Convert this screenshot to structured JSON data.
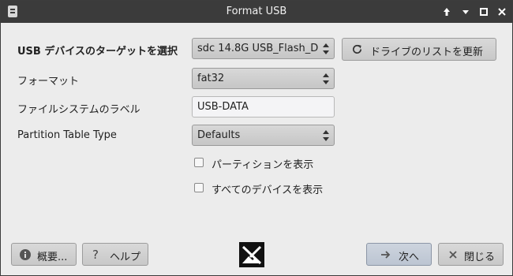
{
  "window": {
    "title": "Format USB",
    "controls": {
      "up_label": "↑",
      "minimize_label": "▾",
      "maximize_label": "□",
      "close_label": "✕"
    }
  },
  "form": {
    "target_label": "USB デバイスのターゲットを選択",
    "target_value": "sdc  14.8G USB_Flash_D",
    "refresh_label": "ドライブのリストを更新",
    "format_label": "フォーマット",
    "format_value": "fat32",
    "fs_label_label": "ファイルシステムのラベル",
    "fs_label_value": "USB-DATA",
    "partition_label": "Partition Table Type",
    "partition_value": "Defaults",
    "show_partitions_label": "パーティションを表示",
    "show_all_devices_label": "すべてのデバイスを表示",
    "show_partitions_checked": false,
    "show_all_devices_checked": false
  },
  "footer": {
    "about_label": "概要...",
    "help_label": "ヘルプ",
    "next_label": "次へ",
    "close_label": "閉じる"
  },
  "icons": {
    "app": "app-icon",
    "refresh": "refresh-icon",
    "info": "info-icon",
    "help": "question-icon",
    "next": "arrow-right-icon",
    "close": "x-icon",
    "logo": "mx-logo-icon"
  },
  "colors": {
    "titlebar": "#3b3b3b",
    "window_bg": "#ececec",
    "next_button": "#c3cbd6"
  }
}
